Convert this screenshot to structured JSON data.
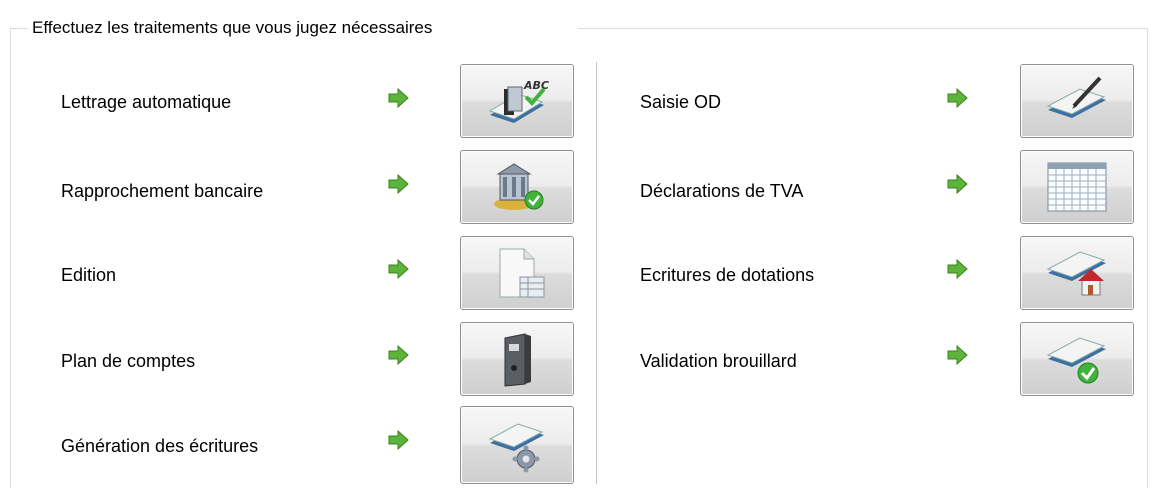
{
  "panel": {
    "title": "Effectuez les traitements que vous jugez nécessaires"
  },
  "left_actions": [
    {
      "label": "Lettrage automatique",
      "icon": "book-abc-check-icon"
    },
    {
      "label": "Rapprochement bancaire",
      "icon": "bank-check-icon"
    },
    {
      "label": "Edition",
      "icon": "document-edition-icon"
    },
    {
      "label": "Plan de comptes",
      "icon": "binder-icon"
    },
    {
      "label": "Génération des écritures",
      "icon": "book-gear-icon"
    }
  ],
  "right_actions": [
    {
      "label": "Saisie OD",
      "icon": "book-pen-icon"
    },
    {
      "label": "Déclarations de TVA",
      "icon": "grid-sheet-icon"
    },
    {
      "label": "Ecritures de dotations",
      "icon": "book-house-icon"
    },
    {
      "label": "Validation brouillard",
      "icon": "book-check-icon"
    }
  ],
  "colors": {
    "arrow_green": "#5db43a",
    "border": "#d5dfe5"
  }
}
